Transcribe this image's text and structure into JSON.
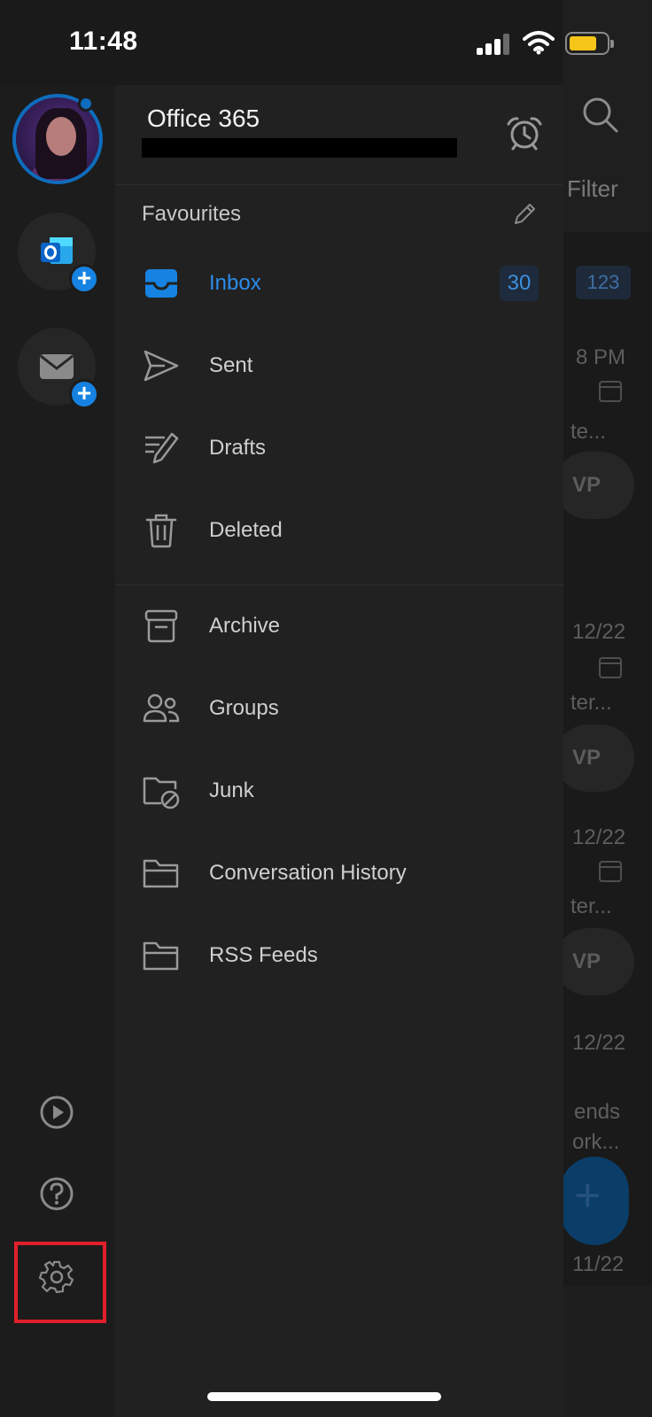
{
  "status_bar": {
    "time": "11:48",
    "battery_color": "#f5c518"
  },
  "account": {
    "title": "Office 365",
    "avatar_accent": "#0f6cbd"
  },
  "rail": {
    "buttons": [
      {
        "name": "add-outlook-account",
        "icon": "outlook-icon"
      },
      {
        "name": "add-mail-account",
        "icon": "mail-icon"
      }
    ],
    "bottom_icons": [
      "play-icon",
      "help-icon",
      "gear-icon"
    ]
  },
  "favourites": {
    "label": "Favourites"
  },
  "folders": [
    {
      "label": "Inbox",
      "icon": "inbox-icon",
      "count": "30",
      "active": true
    },
    {
      "label": "Sent",
      "icon": "send-icon"
    },
    {
      "label": "Drafts",
      "icon": "drafts-icon"
    },
    {
      "label": "Deleted",
      "icon": "trash-icon"
    }
  ],
  "other_folders": [
    {
      "label": "Archive",
      "icon": "archive-icon"
    },
    {
      "label": "Groups",
      "icon": "groups-icon"
    },
    {
      "label": "Junk",
      "icon": "junk-folder-icon"
    },
    {
      "label": "Conversation History",
      "icon": "folder-icon"
    },
    {
      "label": "RSS Feeds",
      "icon": "folder-icon"
    }
  ],
  "background_list": {
    "filter": "Filter",
    "badge": "123",
    "times": [
      "8 PM",
      "12/22",
      "12/22",
      "12/22",
      "11/22"
    ],
    "snippets": [
      "te...",
      "ter...",
      "ter...",
      "ends",
      "ork..."
    ],
    "pill": "VP"
  },
  "colors": {
    "accent": "#2b8cea",
    "highlight_box": "#e0202a"
  }
}
